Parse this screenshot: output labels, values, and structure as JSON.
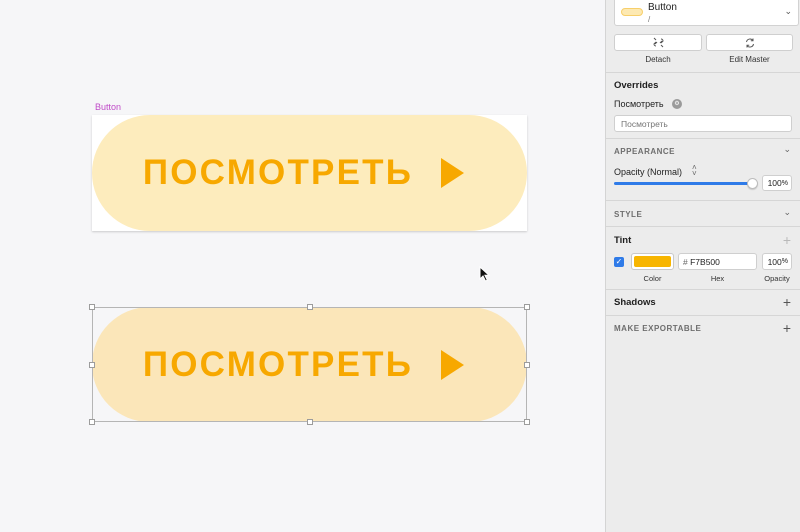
{
  "colors": {
    "accent": "#2f7be8",
    "tint": "#F7B500",
    "pill_fill_top": "#fdecbd",
    "pill_fill_bottom": "#fbe6b9",
    "pill_text": "#f7a800",
    "artboard_label": "#c04bc8"
  },
  "canvas": {
    "artboard_label": "Button",
    "master_button": {
      "label": "ПОСМОТРЕТЬ",
      "icon": "play-triangle-icon"
    },
    "instance_button": {
      "label": "ПОСМОТРЕТЬ",
      "icon": "play-triangle-icon"
    }
  },
  "inspector": {
    "symbol": {
      "name": "Button",
      "path": "/",
      "dropdown_icon": "chevron-down-icon"
    },
    "detach": {
      "label": "Detach",
      "icon": "detach-link-icon"
    },
    "edit_master": {
      "label": "Edit Master",
      "icon": "refresh-icon"
    },
    "overrides": {
      "title": "Overrides",
      "field_label": "Посмотреть",
      "placeholder": "Посмотреть"
    },
    "appearance": {
      "title": "APPEARANCE",
      "opacity_label": "Opacity (Normal)",
      "opacity_value": "100",
      "opacity_unit": "%",
      "opacity_level": 1.0
    },
    "style": {
      "title": "STYLE"
    },
    "tint": {
      "title": "Tint",
      "enabled": true,
      "hex_prefix": "#",
      "hex_value": "F7B500",
      "opacity_value": "100",
      "opacity_unit": "%",
      "captions": {
        "color": "Color",
        "hex": "Hex",
        "opacity": "Opacity"
      }
    },
    "shadows": {
      "title": "Shadows"
    },
    "exportable": {
      "title": "MAKE EXPORTABLE"
    }
  }
}
